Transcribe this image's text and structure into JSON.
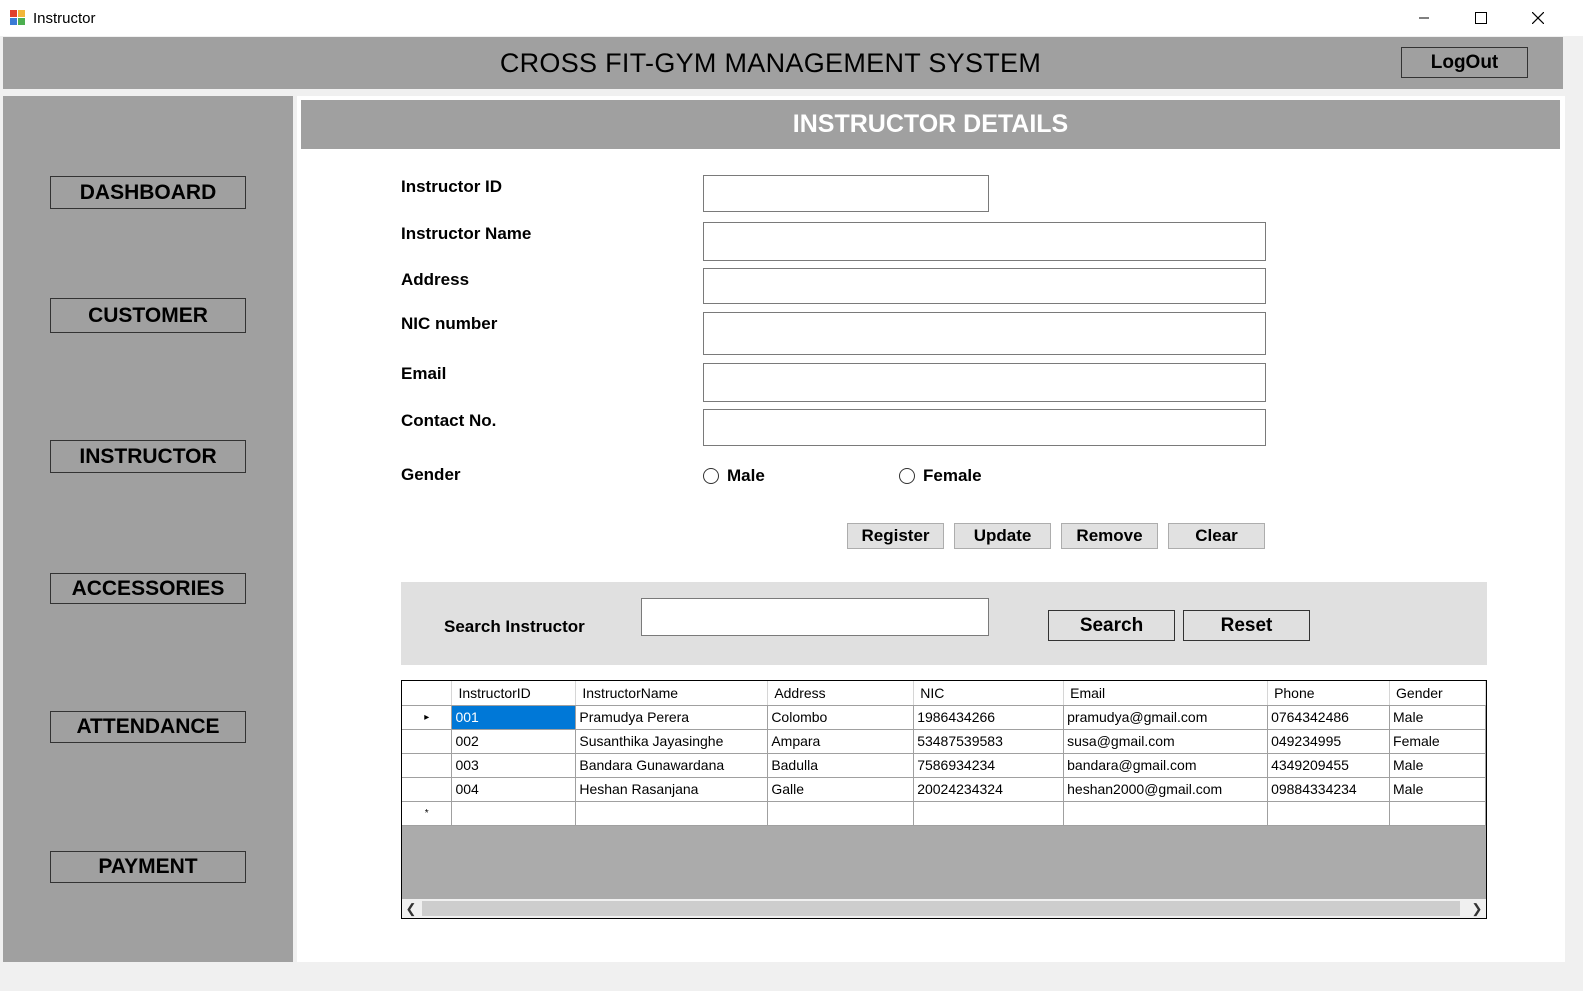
{
  "window": {
    "title": "Instructor"
  },
  "header": {
    "title": "CROSS FIT-GYM MANAGEMENT SYSTEM",
    "logout_label": "LogOut"
  },
  "sidebar": {
    "items": [
      {
        "label": "DASHBOARD"
      },
      {
        "label": "CUSTOMER"
      },
      {
        "label": "INSTRUCTOR"
      },
      {
        "label": "ACCESSORIES"
      },
      {
        "label": "ATTENDANCE"
      },
      {
        "label": "PAYMENT"
      }
    ]
  },
  "form": {
    "heading": "INSTRUCTOR DETAILS",
    "labels": {
      "id": "Instructor ID",
      "name": "Instructor Name",
      "address": "Address",
      "nic": "NIC number",
      "email": "Email",
      "contact": "Contact No.",
      "gender": "Gender"
    },
    "values": {
      "id": "",
      "name": "",
      "address": "",
      "nic": "",
      "email": "",
      "contact": ""
    },
    "gender_options": {
      "male": "Male",
      "female": "Female"
    },
    "buttons": {
      "register": "Register",
      "update": "Update",
      "remove": "Remove",
      "clear": "Clear"
    }
  },
  "search": {
    "label": "Search Instructor",
    "value": "",
    "search_label": "Search",
    "reset_label": "Reset"
  },
  "grid": {
    "columns": [
      "InstructorID",
      "InstructorName",
      "Address",
      "NIC",
      "Email",
      "Phone",
      "Gender"
    ],
    "rows": [
      [
        "001",
        "Pramudya Perera",
        "Colombo",
        "1986434266",
        "pramudya@gmail.com",
        "0764342486",
        "Male"
      ],
      [
        "002",
        "Susanthika Jayasinghe",
        "Ampara",
        "53487539583",
        "susa@gmail.com",
        "049234995",
        "Female"
      ],
      [
        "003",
        "Bandara Gunawardana",
        "Badulla",
        "7586934234",
        "bandara@gmail.com",
        "4349209455",
        "Male"
      ],
      [
        "004",
        "Heshan Rasanjana",
        "Galle",
        "20024234324",
        "heshan2000@gmail.com",
        "09884334234",
        "Male"
      ]
    ],
    "current_row_marker": "▸",
    "new_row_marker": "*"
  },
  "icons": {
    "app": "app-icon",
    "minimize": "minimize-icon",
    "maximize": "maximize-icon",
    "close": "close-icon",
    "scroll_left": "scroll-left-icon",
    "scroll_right": "scroll-right-icon"
  },
  "colors": {
    "panel_gray": "#a0a0a0",
    "search_panel": "#e0e0e0",
    "selection": "#0078d7",
    "grid_background": "#ababab"
  }
}
